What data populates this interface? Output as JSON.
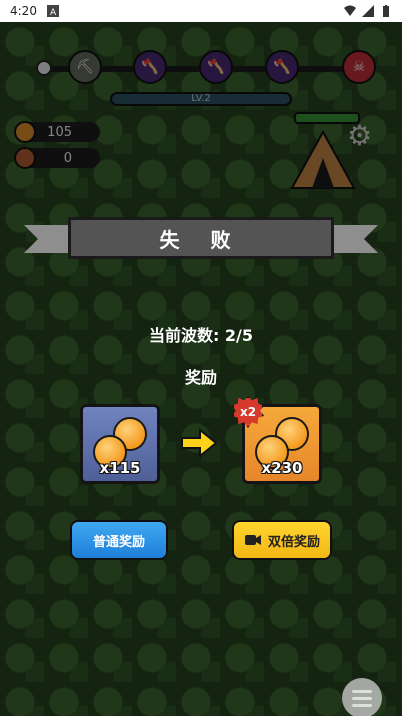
{
  "status_bar": {
    "time": "4:20",
    "icons": [
      "notification-a-icon",
      "wifi-icon",
      "signal-icon",
      "battery-icon"
    ]
  },
  "hud": {
    "level_label": "LV.2",
    "gold": "105",
    "wood": "0",
    "wave_nodes": [
      "pickaxe",
      "axe",
      "axe",
      "axe",
      "boss-skull"
    ]
  },
  "result": {
    "title": "失 败",
    "wave_text": "当前波数: 2/5",
    "reward_label": "奖励",
    "normal_reward": {
      "count": "x115"
    },
    "double_reward": {
      "count": "x230",
      "badge": "x2"
    },
    "buttons": {
      "normal": "普通奖励",
      "double": "双倍奖励"
    }
  },
  "colors": {
    "normal_button": "#2a93e8",
    "double_button": "#f7c51e",
    "banner": "#545454",
    "badge": "#d73a2c"
  }
}
